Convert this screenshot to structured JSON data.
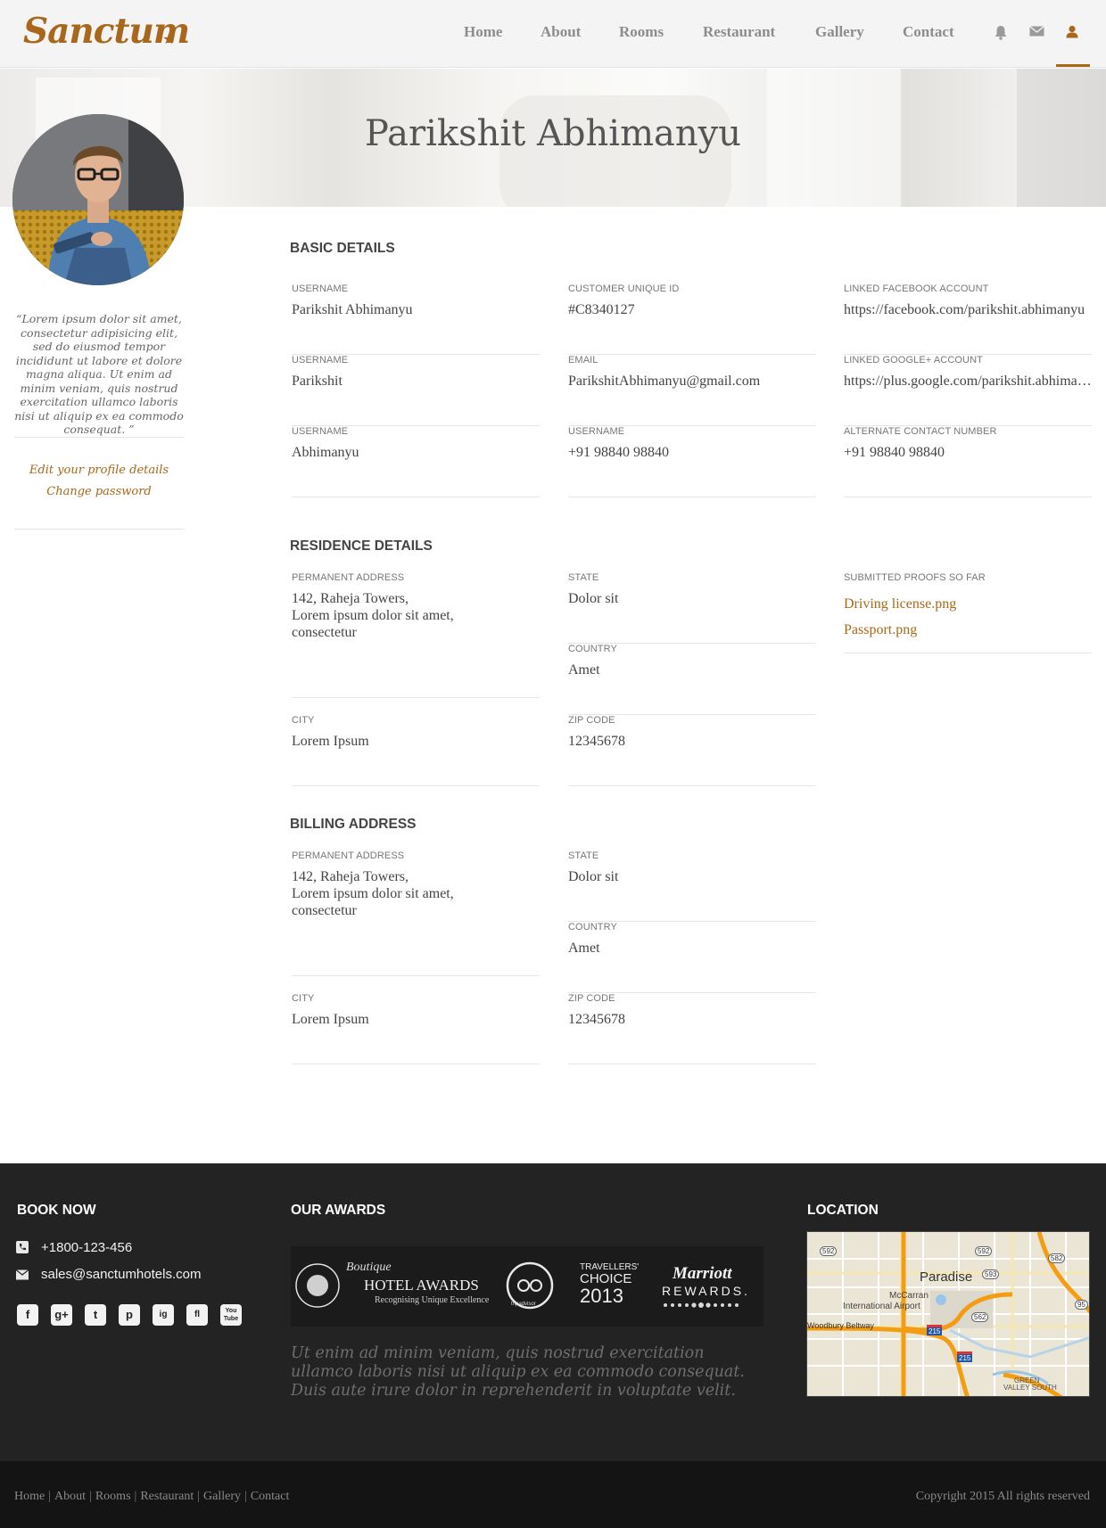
{
  "brand": {
    "logo": "Sanctum"
  },
  "nav": {
    "links": [
      "Home",
      "About",
      "Rooms",
      "Restaurant",
      "Gallery",
      "Contact"
    ],
    "icons": [
      "bell-icon",
      "envelope-icon",
      "user-icon"
    ]
  },
  "profile": {
    "name": "Parikshit Abhimanyu",
    "quote": "“Lorem ipsum dolor sit amet, consectetur adipisicing elit, sed do eiusmod tempor incididunt ut labore et dolore magna aliqua. Ut enim ad minim veniam, quis nostrud exercitation ullamco laboris nisi ut aliquip ex ea commodo consequat. ”",
    "edit_link": "Edit your profile details",
    "password_link": "Change password"
  },
  "basic": {
    "title": "BASIC DETAILS",
    "fields": [
      {
        "label": "USERNAME",
        "value": "Parikshit Abhimanyu"
      },
      {
        "label": "CUSTOMER UNIQUE ID",
        "value": "#C8340127"
      },
      {
        "label": "LINKED FACEBOOK ACCOUNT",
        "value": "https://facebook.com/parikshit.abhimanyu"
      },
      {
        "label": "USERNAME",
        "value": "Parikshit"
      },
      {
        "label": "EMAIL",
        "value": "ParikshitAbhimanyu@gmail.com"
      },
      {
        "label": "LINKED GOOGLE+ ACCOUNT",
        "value": "https://plus.google.com/parikshit.abhimanyu"
      },
      {
        "label": "USERNAME",
        "value": "Abhimanyu"
      },
      {
        "label": "USERNAME",
        "value": "+91 98840 98840"
      },
      {
        "label": "ALTERNATE CONTACT NUMBER",
        "value": "+91 98840 98840"
      }
    ]
  },
  "residence": {
    "title": "RESIDENCE DETAILS",
    "permanent_label": "PERMANENT ADDRESS",
    "permanent_value": "142, Raheja Towers,\nLorem ipsum dolor sit amet,\nconsectetur",
    "state_label": "STATE",
    "state_value": "Dolor sit",
    "country_label": "COUNTRY",
    "country_value": "Amet",
    "city_label": "CITY",
    "city_value": "Lorem Ipsum",
    "zip_label": "ZIP CODE",
    "zip_value": "12345678",
    "proofs_label": "SUBMITTED PROOFS SO FAR",
    "proofs": [
      "Driving license.png",
      "Passport.png"
    ]
  },
  "billing": {
    "title": "BILLING ADDRESS",
    "permanent_label": "PERMANENT ADDRESS",
    "permanent_value": "142, Raheja Towers,\nLorem ipsum dolor sit amet,\nconsectetur",
    "state_label": "STATE",
    "state_value": "Dolor sit",
    "country_label": "COUNTRY",
    "country_value": "Amet",
    "city_label": "CITY",
    "city_value": "Lorem Ipsum",
    "zip_label": "ZIP CODE",
    "zip_value": "12345678"
  },
  "footer": {
    "book_title": "BOOK NOW",
    "phone": "+1800-123-456",
    "email": "sales@sanctumhotels.com",
    "social": [
      "f",
      "g+",
      "t",
      "p",
      "ig",
      "fl",
      "You Tube"
    ],
    "awards_title": "OUR AWARDS",
    "awards": {
      "boutique_line1": "Boutique",
      "boutique_line2": "HOTEL AWARDS",
      "boutique_line3": "Recognising Unique Excellence",
      "tripadvisor_line1": "TRAVELLERS'",
      "tripadvisor_line2": "CHOICE",
      "tripadvisor_line3": "2013",
      "tripadvisor_brand": "tripadvisor",
      "marriott_line1": "Marriott",
      "marriott_line2": "REWARDS."
    },
    "awards_text": "Ut enim ad minim veniam, quis nostrud exercitation ullamco laboris nisi ut aliquip ex ea commodo consequat. Duis aute irure dolor in reprehenderit in voluptate velit.",
    "location_title": "LOCATION",
    "map": {
      "city": "Paradise",
      "airport_line1": "McCarran",
      "airport_line2": "International Airport",
      "beltway": "Woodbury Beltway",
      "valley_line1": "GREEN",
      "valley_line2": "VALLEY SOUTH",
      "route_labels": [
        "592",
        "592",
        "582",
        "593",
        "95",
        "562",
        "215",
        "215"
      ]
    },
    "bottom_links": [
      "Home",
      "About",
      "Rooms",
      "Restaurant",
      "Gallery",
      "Contact"
    ],
    "copyright": "Copyright 2015 All rights reserved"
  },
  "colors": {
    "accent": "#a8671a",
    "footer_bg": "#232323",
    "bottom_bg": "#141414"
  }
}
